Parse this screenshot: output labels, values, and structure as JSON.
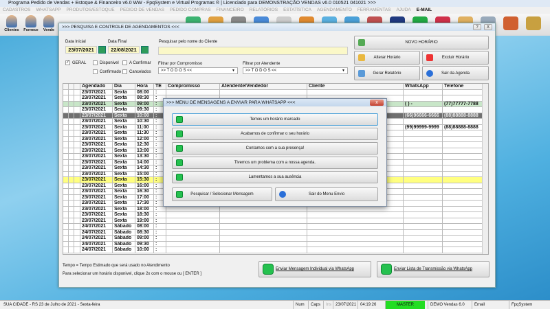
{
  "app": {
    "title": "Programa Pedido de Vendas + Estoque & Financeiro v6.0 WW - FpqSystem e Virtual Programas ® | Licenciado para  DEMONSTRAÇÃO VENDAS v6.0 010521 041021 >>>"
  },
  "menu": [
    "CADASTROS",
    "WHATSAPP",
    "PRODUTOS/ESTOQUE",
    "PEDIDO DE VENDAS",
    "PEDIDO COMPRAS",
    "FINANCEIRO",
    "RELATÓRIOS",
    "ESTATÍSTICA",
    "AGENDAMENTO",
    "FERRAMENTAS",
    "AJUDA",
    "E-MAIL"
  ],
  "sidebar": [
    "Clientes",
    "Fornece",
    "Vende"
  ],
  "window": {
    "title": ">>>  PESQUISA E CONTROLE DE AGENDAMENTOS  <<<",
    "help": "?",
    "close": "X"
  },
  "filters": {
    "data_inicial_label": "Data Inicial",
    "data_inicial": "23/07/2021",
    "data_final_label": "Data Final",
    "data_final": "22/08/2021",
    "search_label": "Pesquisar pelo nome do Cliente",
    "search_value": "",
    "checks": [
      {
        "label": "GERAL",
        "checked": "✓"
      },
      {
        "label": "Disponivel",
        "checked": ""
      },
      {
        "label": "A Confirmar",
        "checked": ""
      },
      {
        "label": "Confirmado",
        "checked": ""
      },
      {
        "label": "Cancelados",
        "checked": ""
      }
    ],
    "compromisso_label": "Filtrar por Compromisso",
    "compromisso": ">> T O D O S <<",
    "atendente_label": "Filtrar por Atendente",
    "atendente": ">> T O D O S <<"
  },
  "actions": {
    "novo": "NOVO HORÁRIO",
    "alterar": "Alterar Horário",
    "excluir": "Excluir Horário",
    "relatorio": "Gerar Relatório",
    "sair": "Sair da Agenda"
  },
  "grid": {
    "columns": [
      "Agendado",
      "Dia",
      "Hora",
      "TE",
      "Compromisso",
      "Atendente/Vendedor",
      "Cliente",
      "WhatsApp",
      "Telefone"
    ],
    "rows": [
      [
        "23/07/2021",
        "Sexta",
        "08:00",
        ":",
        "",
        "",
        "",
        "",
        ""
      ],
      [
        "23/07/2021",
        "Sexta",
        "08:30",
        ":",
        "",
        "",
        "",
        "",
        ""
      ],
      [
        "23/07/2021",
        "Sexta",
        "09:00",
        ":",
        "",
        "",
        "",
        "( )   -",
        "(77)77777-7788"
      ],
      [
        "23/07/2021",
        "Sexta",
        "09:30",
        ":",
        "",
        "",
        "",
        "",
        ""
      ],
      [
        "23/07/2021",
        "Sexta",
        "10:00",
        ":",
        "",
        "",
        "",
        "(66)96666-6666",
        "(88)88888-8888"
      ],
      [
        "23/07/2021",
        "Sexta",
        "10:30",
        ":",
        "",
        "",
        "",
        "",
        ""
      ],
      [
        "23/07/2021",
        "Sexta",
        "11:00",
        ":",
        "",
        "",
        "",
        "(99)99999-9999",
        "(88)88888-8888"
      ],
      [
        "23/07/2021",
        "Sexta",
        "11:30",
        ":",
        "",
        "",
        "",
        "",
        ""
      ],
      [
        "23/07/2021",
        "Sexta",
        "12:00",
        ":",
        "",
        "",
        "",
        "",
        ""
      ],
      [
        "23/07/2021",
        "Sexta",
        "12:30",
        ":",
        "",
        "",
        "",
        "",
        ""
      ],
      [
        "23/07/2021",
        "Sexta",
        "13:00",
        ":",
        "",
        "",
        "",
        "",
        ""
      ],
      [
        "23/07/2021",
        "Sexta",
        "13:30",
        ":",
        "",
        "",
        "",
        "",
        ""
      ],
      [
        "23/07/2021",
        "Sexta",
        "14:00",
        ":",
        "",
        "",
        "",
        "",
        ""
      ],
      [
        "23/07/2021",
        "Sexta",
        "14:30",
        ":",
        "",
        "",
        "",
        "",
        ""
      ],
      [
        "23/07/2021",
        "Sexta",
        "15:00",
        ":",
        "",
        "",
        "",
        "",
        ""
      ],
      [
        "23/07/2021",
        "Sexta",
        "15:30",
        ":",
        "",
        "",
        "",
        "",
        ""
      ],
      [
        "23/07/2021",
        "Sexta",
        "16:00",
        ":",
        "",
        "",
        "",
        "",
        ""
      ],
      [
        "23/07/2021",
        "Sexta",
        "16:30",
        ":",
        "",
        "",
        "",
        "",
        ""
      ],
      [
        "23/07/2021",
        "Sexta",
        "17:00",
        ":",
        "",
        "",
        "",
        "",
        ""
      ],
      [
        "23/07/2021",
        "Sexta",
        "17:30",
        ":",
        "",
        "",
        "",
        "",
        ""
      ],
      [
        "23/07/2021",
        "Sexta",
        "18:00",
        ":",
        "",
        "",
        "",
        "",
        ""
      ],
      [
        "23/07/2021",
        "Sexta",
        "18:30",
        ":",
        "",
        "",
        "",
        "",
        ""
      ],
      [
        "23/07/2021",
        "Sexta",
        "19:00",
        ":",
        "",
        "",
        "",
        "",
        ""
      ],
      [
        "24/07/2021",
        "Sábado",
        "08:00",
        ":",
        "",
        "",
        "",
        "",
        ""
      ],
      [
        "24/07/2021",
        "Sábado",
        "08:30",
        ":",
        "",
        "",
        "",
        "",
        ""
      ],
      [
        "24/07/2021",
        "Sábado",
        "09:00",
        ":",
        "",
        "",
        "",
        "",
        ""
      ],
      [
        "24/07/2021",
        "Sábado",
        "09:30",
        ":",
        "",
        "",
        "",
        "",
        ""
      ],
      [
        "24/07/2021",
        "Sábado",
        "10:00",
        ":",
        "",
        "",
        "",
        "",
        ""
      ]
    ],
    "row_colors": {
      "2": "#c8e6c8",
      "4": "#707070",
      "15": "#ffff80"
    }
  },
  "footer": {
    "note1": "Tempo = Tempo Estimado que será usado no Atendimento",
    "note2": "Para selecionar um horário disponivel, clique 2x com o mouse ou [ ENTER ]",
    "send_individual": "Enviar Mensagem Individual via WhatsApp",
    "send_list": "Enviar Lista de Transmissão via WhatsApp"
  },
  "dialog": {
    "title": ">>> MENU DE MENSAGENS A ENVIAR PARA WHATSAPP <<<",
    "messages": [
      "Temos um horário marcado",
      "Acabamos de confirmar o seu horário",
      "Contamos com a sua presença!",
      "Tivemos um problema com a nossa agenda.",
      "Lamentamos a sua ausência"
    ],
    "search": "Pesquisar / Selecionar Mensagem",
    "exit": "Sair do Menu Envio",
    "close": "x"
  },
  "status": {
    "city": "SUA CIDADE - RS 23 de Julho de 2021 - Sexta-feira",
    "num": "Num",
    "caps": "Caps",
    "ins": "Ins",
    "date": "23/07/2021",
    "time": "04:19:26",
    "user": "MASTER",
    "demo": "DEMO Vendas 6.0",
    "email": "Email",
    "system": "FpqSystem"
  },
  "colors": {
    "whatsapp": "#25c14f",
    "master": "#22dd22",
    "yellow_row": "#ffff80",
    "green_row": "#c8e6c8"
  }
}
